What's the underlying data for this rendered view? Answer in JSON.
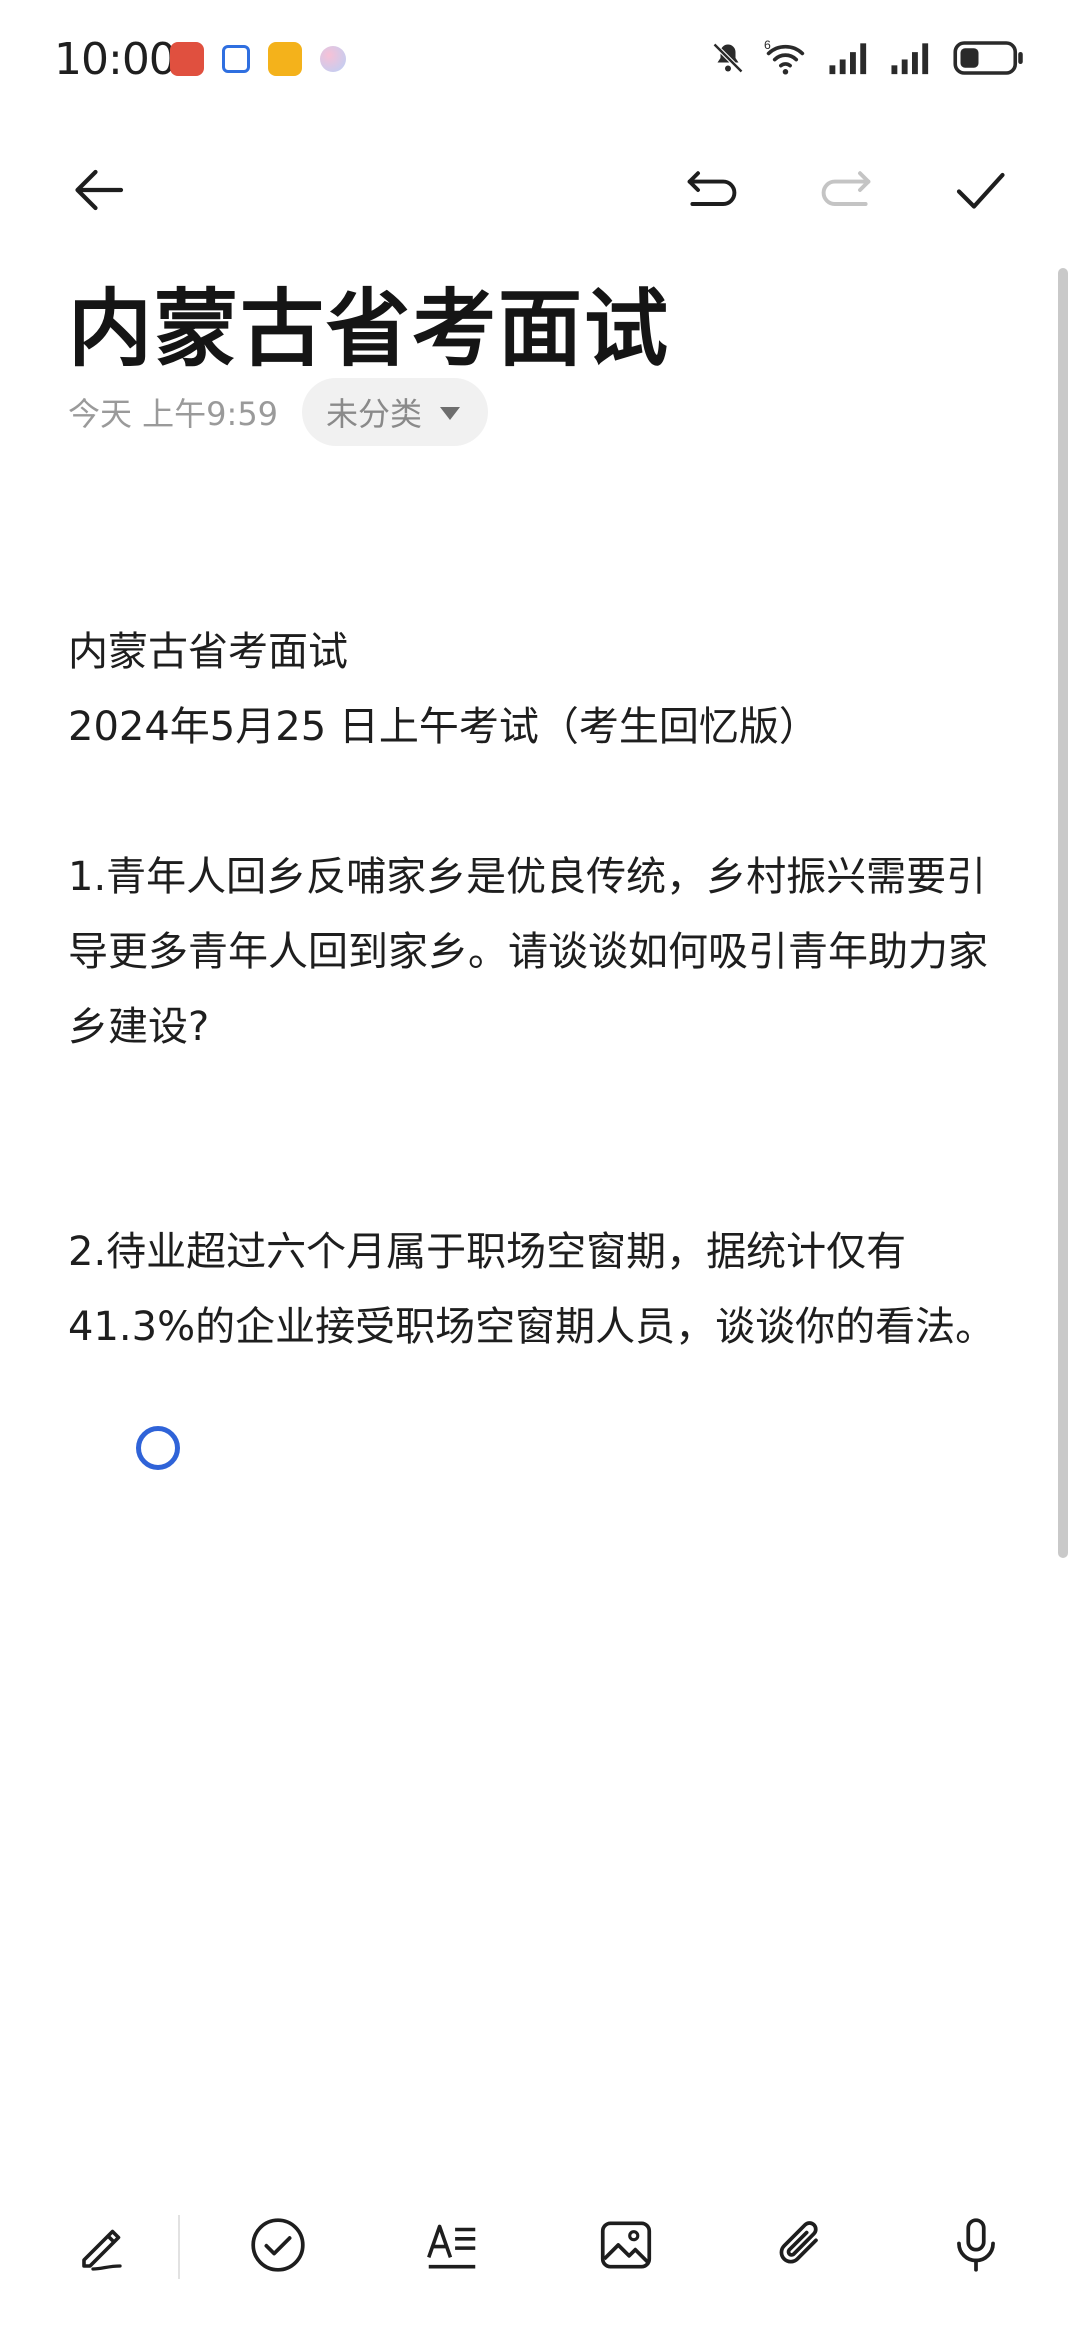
{
  "status_bar": {
    "time": "10:00",
    "app_icons": [
      "notification-app-red-icon",
      "notification-app-blue-icon",
      "notification-app-yellow-icon",
      "notification-app-pastel-icon"
    ],
    "system_icons": [
      "mute-bell-icon",
      "wifi-6-icon",
      "signal-icon",
      "signal-icon",
      "battery-icon"
    ],
    "wifi_badge": "6"
  },
  "toolbar": {
    "back": "back-arrow-icon",
    "undo": "undo-icon",
    "redo": "redo-icon",
    "done": "checkmark-icon"
  },
  "note": {
    "title": "内蒙古省考面试",
    "time": "今天 上午9:59",
    "category": "未分类",
    "body": {
      "line1": "内蒙古省考面试",
      "line2": "2024年5月25 日上午考试（考生回忆版）",
      "q1": "1.青年人回乡反哺家乡是优良传统，乡村振兴需要引导更多青年人回到家乡。请谈谈如何吸引青年助力家乡建设?",
      "q2": "2.待业超过六个月属于职场空窗期，据统计仅有41.3%的企业接受职场空窗期人员，谈谈你的看法。"
    }
  },
  "bottom_toolbar": [
    "pen-icon",
    "checklist-icon",
    "text-format-icon",
    "image-icon",
    "attachment-icon",
    "microphone-icon"
  ],
  "colors": {
    "accent": "#2f63d8",
    "text": "#1e1e1e",
    "muted": "#9a9a9a",
    "chip_bg": "#f1f1f1"
  }
}
